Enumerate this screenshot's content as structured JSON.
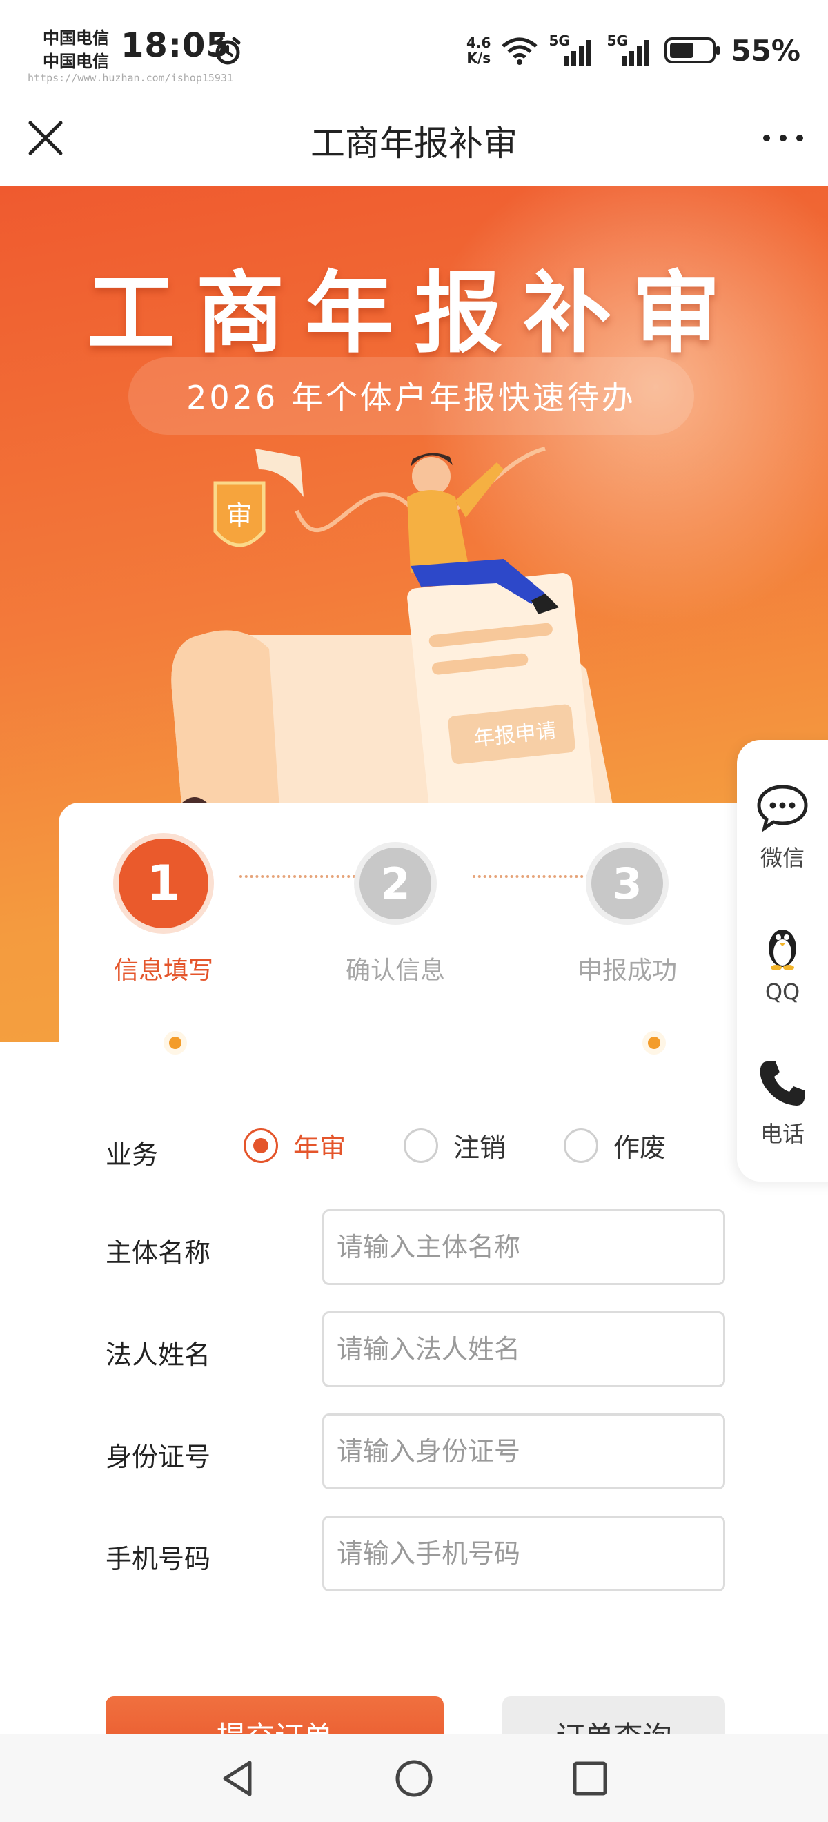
{
  "status_bar": {
    "carrier_1": "中国电信",
    "carrier_2": "中国电信",
    "time": "18:05",
    "url": "https://www.huzhan.com/ishop15931",
    "net_speed_value": "4.6",
    "net_speed_unit": "K/s",
    "signal_1": "5G",
    "signal_2": "5G",
    "battery": "55%"
  },
  "title_bar": {
    "title": "工商年报补审"
  },
  "hero": {
    "title": "工商年报补审",
    "subtitle": "2026 年个体户年报快速待办",
    "badge_char": "审",
    "doc_label": "年报申请"
  },
  "steps": [
    {
      "number": "1",
      "label": "信息填写",
      "active": true
    },
    {
      "number": "2",
      "label": "确认信息",
      "active": false
    },
    {
      "number": "3",
      "label": "申报成功",
      "active": false
    }
  ],
  "form": {
    "business_label": "业务",
    "business_options": [
      {
        "label": "年审",
        "checked": true
      },
      {
        "label": "注销",
        "checked": false
      },
      {
        "label": "作废",
        "checked": false
      }
    ],
    "fields": [
      {
        "label": "主体名称",
        "placeholder": "请输入主体名称",
        "value": ""
      },
      {
        "label": "法人姓名",
        "placeholder": "请输入法人姓名",
        "value": ""
      },
      {
        "label": "身份证号",
        "placeholder": "请输入身份证号",
        "value": ""
      },
      {
        "label": "手机号码",
        "placeholder": "请输入手机号码",
        "value": ""
      }
    ],
    "submit_label": "提交订单",
    "secondary_label": "订单查询"
  },
  "side_panel": {
    "items": [
      {
        "label": "微信",
        "icon": "chat-bubble-icon"
      },
      {
        "label": "QQ",
        "icon": "penguin-icon"
      },
      {
        "label": "电话",
        "icon": "phone-icon"
      }
    ]
  },
  "colors": {
    "accent": "#e4552b",
    "hero_top": "#ef5a2f",
    "hero_bottom": "#f3a43f",
    "inactive": "#b9b9b9"
  }
}
